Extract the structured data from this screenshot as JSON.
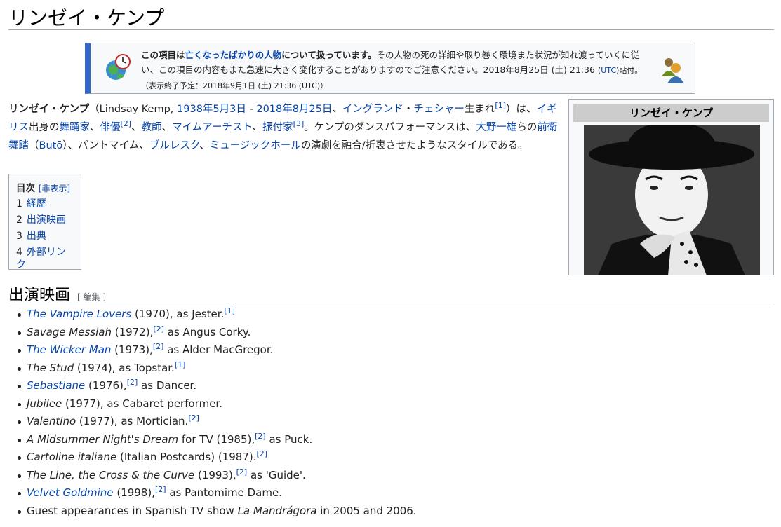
{
  "page": {
    "title": "リンゼイ・ケンプ"
  },
  "notice": {
    "lead_bold_1": "この項目は",
    "lead_link": "亡くなったばかりの人物",
    "lead_bold_2": "について扱っています。",
    "body": "その人物の死の詳細や取り巻く環境また状況が知れ渡っていくに従い、この項目の内容もまた急速に大きく変化することがありますのでご注意ください。",
    "date": "2018年8月25日 (土) 21:36",
    "utc_link": "UTC",
    "posted": "貼付。",
    "end_note": "（表示終了予定：2018年9月1日 (土) 21:36 (UTC)）",
    "icon_left": "clock-globe-icon",
    "icon_right": "people-icon"
  },
  "lead": {
    "name": "リンゼイ・ケンプ",
    "t1": "（Lindsay Kemp, ",
    "birth": "1938年5月3日",
    "t2": " - ",
    "death": "2018年8月25日",
    "t3": "、",
    "eng": "イングランド",
    "t4": "・",
    "chester": "チェシャー",
    "t5": "生まれ",
    "ref1": "[1]",
    "t6": "）は、",
    "uk": "イギリス",
    "t7": "出身の",
    "dancer": "舞踊家",
    "t8": "、",
    "actor": "俳優",
    "ref2": "[2]",
    "t9": "、",
    "teacher": "教師",
    "t10": "、",
    "mime": "マイムアーチスト",
    "t11": "、",
    "choreo": "振付家",
    "ref3": "[3]",
    "t12": "。ケンプのダンスパフォーマンスは、",
    "ohno": "大野一雄",
    "t13": "らの",
    "butoh": "前衛舞踏",
    "t14": "（",
    "buto": "Butō",
    "t15": "）、パントマイム、",
    "burlesque": "ブルレスク",
    "t16": "、",
    "music_hall": "ミュージックホール",
    "t17": "の演劇を融合/折衷させたようなスタイルである。"
  },
  "toc": {
    "heading": "目次",
    "toggle": "[非表示]",
    "items": [
      {
        "num": "1",
        "label": "経歴"
      },
      {
        "num": "2",
        "label": "出演映画"
      },
      {
        "num": "3",
        "label": "出典"
      },
      {
        "num": "4",
        "label": "外部リンク"
      }
    ]
  },
  "infobox": {
    "caption": "リンゼイ・ケンプ"
  },
  "section": {
    "heading": "出演映画",
    "edit": "[ 編集 ]"
  },
  "films": [
    {
      "title": "The Vampire Lovers",
      "linked": true,
      "rest": " (1970), as Jester.",
      "ref": "[1]"
    },
    {
      "title": "Savage Messiah",
      "linked": false,
      "rest": " (1972),",
      "ref": "[2]",
      "after": " as Angus Corky."
    },
    {
      "title": "The Wicker Man",
      "linked": true,
      "rest": " (1973),",
      "ref": "[2]",
      "after": " as Alder MacGregor."
    },
    {
      "title": "The Stud",
      "linked": false,
      "rest": " (1974), as Topstar.",
      "ref": "[1]"
    },
    {
      "title": "Sebastiane",
      "linked": true,
      "rest": " (1976),",
      "ref": "[2]",
      "after": " as Dancer."
    },
    {
      "title": "Jubilee",
      "linked": false,
      "rest": " (1977), as Cabaret performer."
    },
    {
      "title": "Valentino",
      "linked": false,
      "rest": " (1977), as Mortician.",
      "ref": "[2]"
    },
    {
      "title": "A Midsummer Night's Dream",
      "linked": false,
      "rest": " for TV (1985),",
      "ref": "[2]",
      "after": " as Puck."
    },
    {
      "title": "Cartoline italiane",
      "linked": false,
      "rest": " (Italian Postcards) (1987).",
      "ref": "[2]"
    },
    {
      "title": "The Line, the Cross & the Curve",
      "linked": false,
      "rest": " (1993),",
      "ref": "[2]",
      "after": " as 'Guide'."
    },
    {
      "title": "Velvet Goldmine",
      "linked": true,
      "rest": " (1998),",
      "ref": "[2]",
      "after": " as Pantomime Dame."
    }
  ],
  "guest": {
    "t1": "Guest appearances in Spanish TV show ",
    "show": "La Mandrágora",
    "t2": " in 2005 and 2006."
  }
}
